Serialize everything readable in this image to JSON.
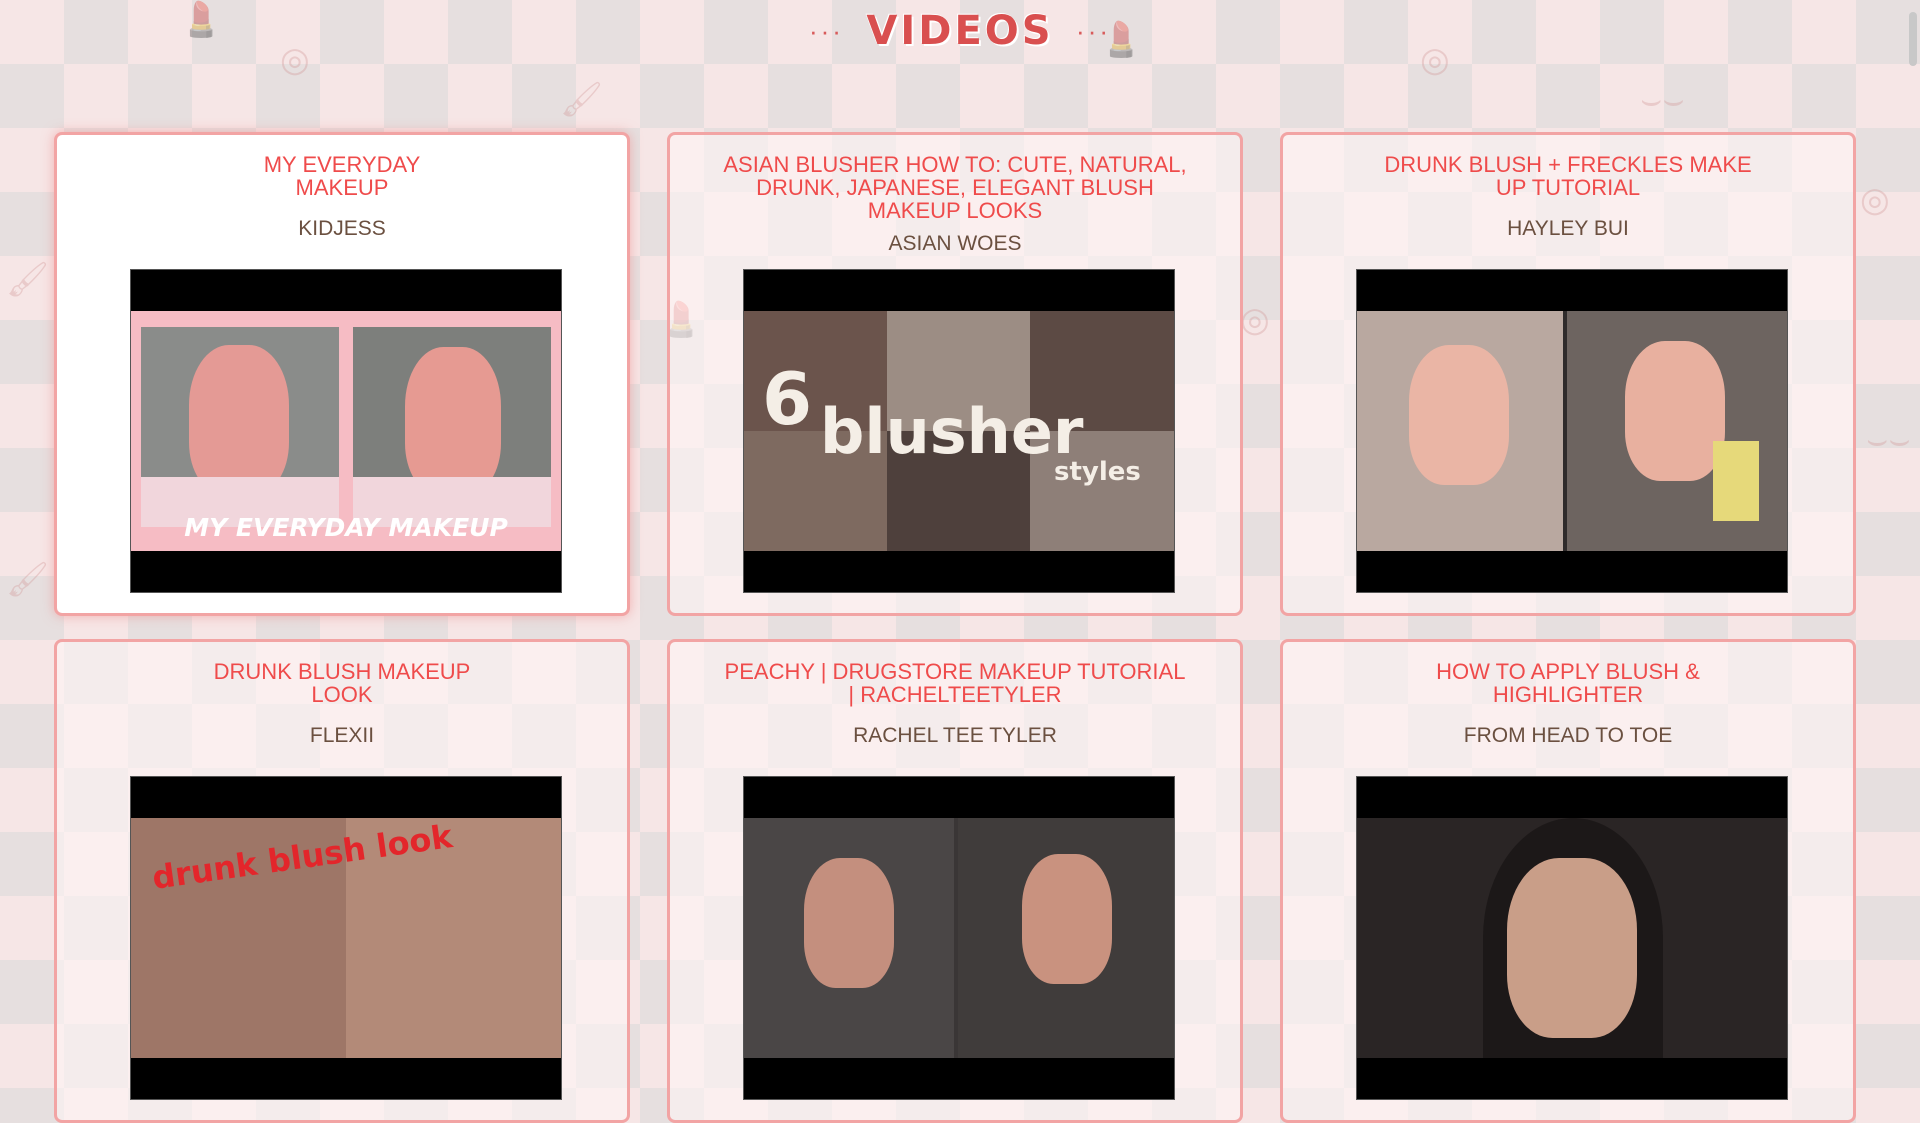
{
  "header": {
    "title": "VIDEOS",
    "left_dots": "···",
    "right_dots": "···"
  },
  "videos": [
    {
      "title": "MY EVERYDAY MAKEUP",
      "author": "KIDJESS",
      "thumb_caption": "MY EVERYDAY MAKEUP"
    },
    {
      "title": "ASIAN BLUSHER HOW TO: CUTE, NATURAL, DRUNK, JAPANESE, ELEGANT BLUSH MAKEUP LOOKS",
      "author": "ASIAN WOES",
      "thumb_caption": "blusher",
      "thumb_number": "6",
      "thumb_sub": "styles"
    },
    {
      "title": "DRUNK BLUSH + FRECKLES MAKE UP TUTORIAL",
      "author": "HAYLEY BUI"
    },
    {
      "title": "DRUNK BLUSH MAKEUP LOOK",
      "author": "FLEXII",
      "thumb_caption": "drunk blush look"
    },
    {
      "title": "PEACHY | DRUGSTORE MAKEUP TUTORIAL | RACHELTEETYLER",
      "author": "RACHEL TEE TYLER"
    },
    {
      "title": "HOW TO APPLY BLUSH & HIGHLIGHTER",
      "author": "FROM HEAD TO TOE"
    }
  ]
}
